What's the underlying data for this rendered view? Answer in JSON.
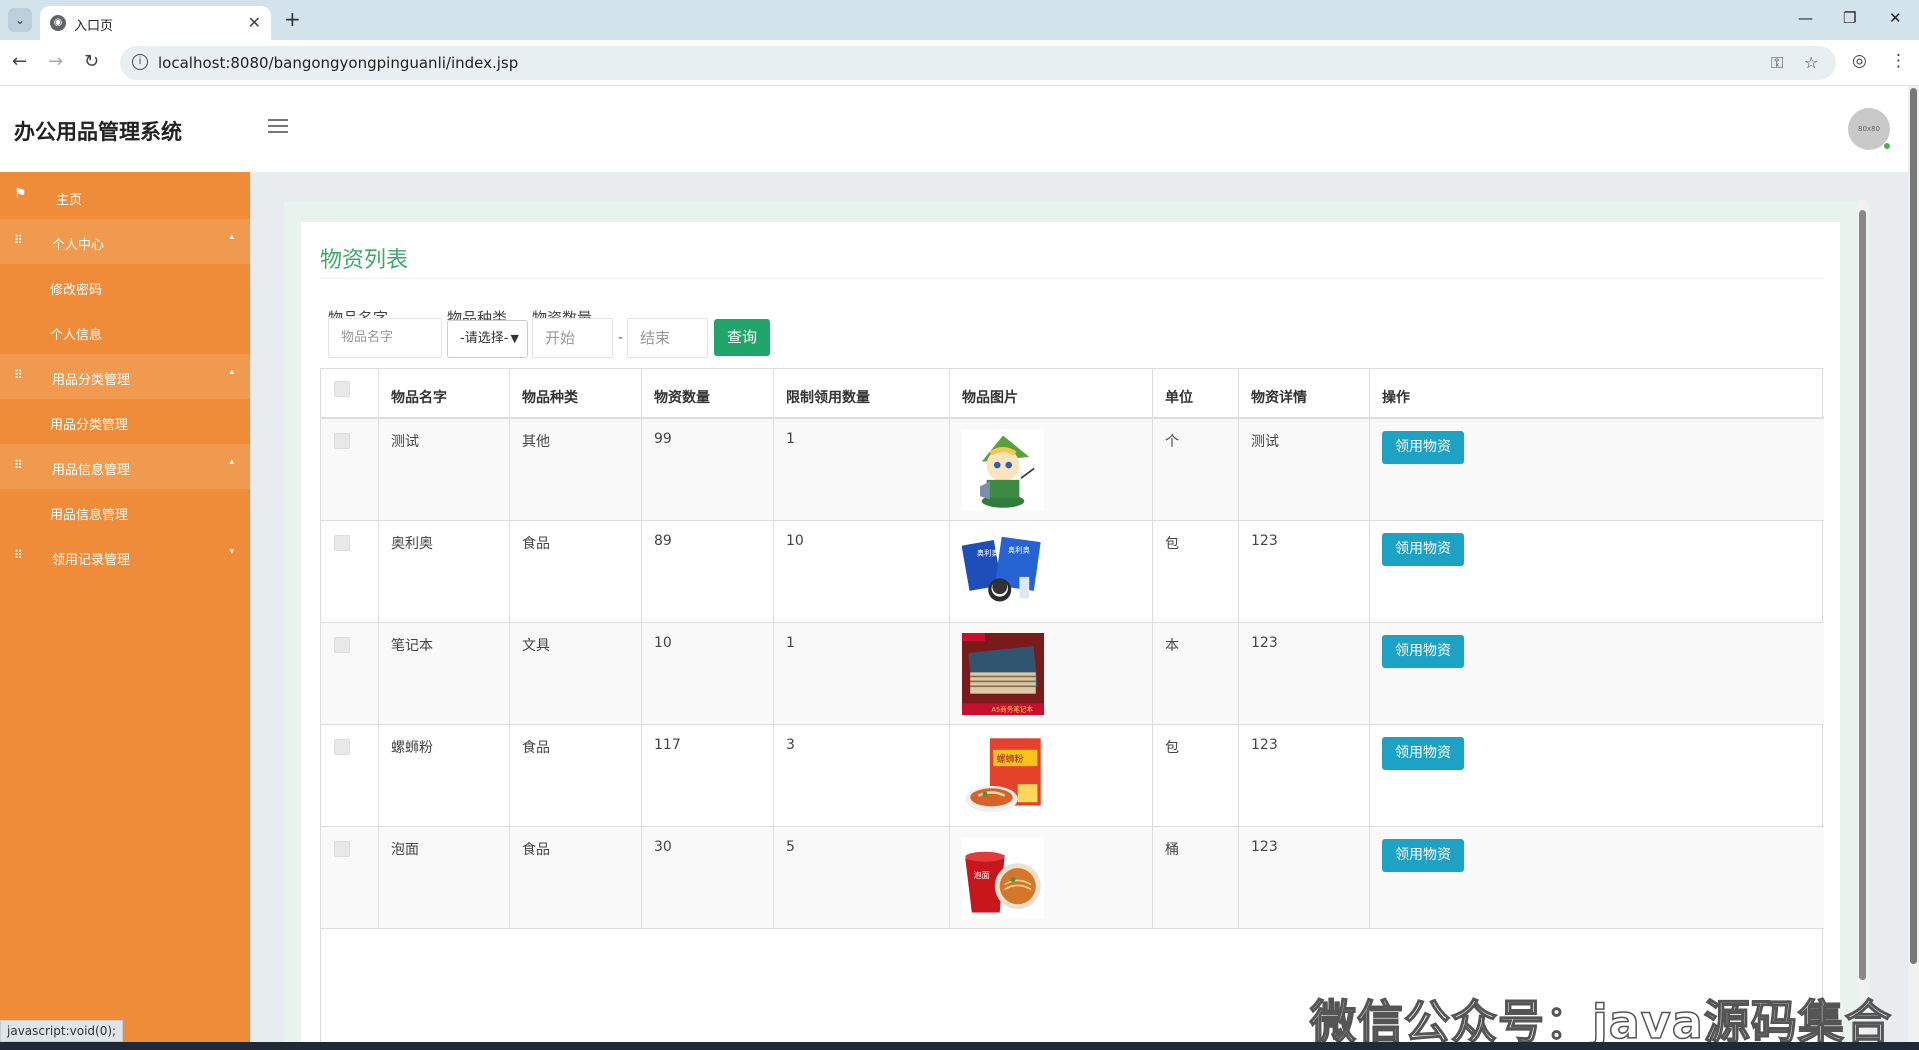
{
  "browser": {
    "tab_title": "入口页",
    "url": "localhost:8080/bangongyongpinguanli/index.jsp",
    "status_text": "javascript:void(0);"
  },
  "header": {
    "app_title": "办公用品管理系统",
    "avatar_text": "80x80"
  },
  "sidebar": {
    "items": [
      {
        "label": "主页",
        "icon": "flag-icon"
      },
      {
        "label": "个人中心",
        "icon": "grid-icon"
      },
      {
        "label": "修改密码"
      },
      {
        "label": "个人信息"
      },
      {
        "label": "用品分类管理",
        "icon": "grid-icon"
      },
      {
        "label": "用品分类管理"
      },
      {
        "label": "用品信息管理",
        "icon": "grid-icon"
      },
      {
        "label": "用品信息管理"
      },
      {
        "label": "领用记录管理",
        "icon": "grid-icon"
      }
    ],
    "color": "#ee8c3a"
  },
  "panel": {
    "title": "物资列表",
    "title_color": "#3fa86a"
  },
  "filters": {
    "name_label": "物品名字",
    "name_placeholder": "物品名字",
    "type_label": "物品种类",
    "type_selected": "-请选择-",
    "qty_label": "物资数量",
    "qty_start_placeholder": "开始",
    "qty_end_placeholder": "结束",
    "dash": "-",
    "query_label": "查询"
  },
  "table": {
    "headers": [
      "物品名字",
      "物品种类",
      "物资数量",
      "限制领用数量",
      "物品图片",
      "单位",
      "物资详情",
      "操作"
    ],
    "action_label": "领用物资",
    "rows": [
      {
        "name": "测试",
        "type": "其他",
        "qty": "99",
        "limit": "1",
        "image": "cartoon-character",
        "unit": "个",
        "detail": "测试"
      },
      {
        "name": "奥利奥",
        "type": "食品",
        "qty": "89",
        "limit": "10",
        "image": "oreo-package",
        "unit": "包",
        "detail": "123"
      },
      {
        "name": "笔记本",
        "type": "文具",
        "qty": "10",
        "limit": "1",
        "image": "notebook",
        "unit": "本",
        "detail": "123"
      },
      {
        "name": "螺蛳粉",
        "type": "食品",
        "qty": "117",
        "limit": "3",
        "image": "noodle-package",
        "unit": "包",
        "detail": "123"
      },
      {
        "name": "泡面",
        "type": "食品",
        "qty": "30",
        "limit": "5",
        "image": "instant-noodle-cup",
        "unit": "桶",
        "detail": "123"
      }
    ]
  },
  "watermark": "微信公众号：java源码集合"
}
